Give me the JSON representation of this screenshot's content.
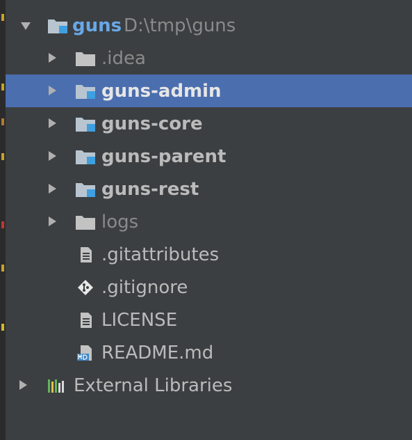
{
  "colors": {
    "background": "#3c3f41",
    "selection": "#4b6eaf",
    "text": "#bbbbbb",
    "root_text": "#68a8e8",
    "dim_text": "#8a8a8a",
    "module_folder": "#b8c5d1",
    "module_badge": "#3f9fe0"
  },
  "tree": {
    "root": {
      "name": "guns",
      "path": "D:\\tmp\\guns",
      "icon": "module-folder-icon",
      "expanded": true
    },
    "items": [
      {
        "label": ".idea",
        "icon": "folder-icon",
        "expandable": true,
        "style": "normal"
      },
      {
        "label": "guns-admin",
        "icon": "module-folder-icon",
        "expandable": true,
        "style": "bold",
        "selected": true
      },
      {
        "label": "guns-core",
        "icon": "module-folder-icon",
        "expandable": true,
        "style": "bold"
      },
      {
        "label": "guns-parent",
        "icon": "module-folder-icon",
        "expandable": true,
        "style": "bold"
      },
      {
        "label": "guns-rest",
        "icon": "module-folder-icon",
        "expandable": true,
        "style": "bold"
      },
      {
        "label": "logs",
        "icon": "folder-icon",
        "expandable": true,
        "style": "dim"
      },
      {
        "label": ".gitattributes",
        "icon": "text-file-icon",
        "expandable": false,
        "style": "normal"
      },
      {
        "label": ".gitignore",
        "icon": "git-diamond-icon",
        "expandable": false,
        "style": "normal"
      },
      {
        "label": "LICENSE",
        "icon": "text-file-icon",
        "expandable": false,
        "style": "normal"
      },
      {
        "label": "README.md",
        "icon": "markdown-file-icon",
        "expandable": false,
        "style": "normal"
      }
    ],
    "external": {
      "label": "External Libraries",
      "icon": "libraries-icon",
      "expandable": true
    }
  }
}
